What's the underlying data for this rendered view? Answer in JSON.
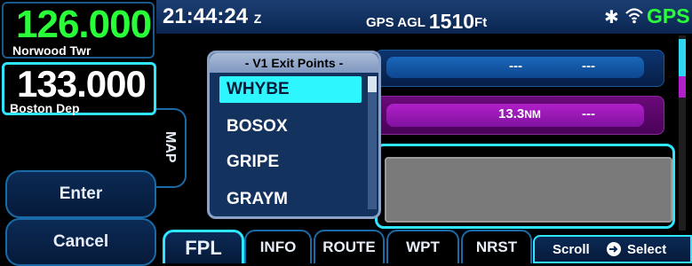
{
  "frequencies": {
    "active": {
      "value": "126.000",
      "name": "Norwood Twr"
    },
    "standby": {
      "value": "133.000",
      "name": "Boston Dep"
    }
  },
  "side_buttons": {
    "enter": "Enter",
    "cancel": "Cancel",
    "map_tab": "MAP"
  },
  "status_bar": {
    "time": "21:44:24",
    "time_zone": "Z",
    "agl_label": "GPS AGL",
    "agl_value": "1510",
    "agl_unit": "Ft",
    "gps_status": "GPS",
    "icons": [
      "bluetooth-icon",
      "wifi-icon"
    ]
  },
  "rows": {
    "row1": {
      "field1": "---",
      "field2": "---"
    },
    "row2": {
      "distance": "13.3",
      "distance_unit": "NM",
      "field2": "---"
    }
  },
  "popup": {
    "title": "- V1 Exit Points -",
    "items": [
      "WHYBE",
      "BOSOX",
      "GRIPE",
      "GRAYM"
    ],
    "selected": "WHYBE"
  },
  "tabs": [
    "FPL",
    "INFO",
    "ROUTE",
    "WPT",
    "NRST"
  ],
  "active_tab": "FPL",
  "hint": {
    "scroll": "Scroll",
    "select": "Select"
  },
  "colors": {
    "active_freq": "#29ff38",
    "highlight": "#2ef6ff",
    "magenta": "#b020c8"
  }
}
